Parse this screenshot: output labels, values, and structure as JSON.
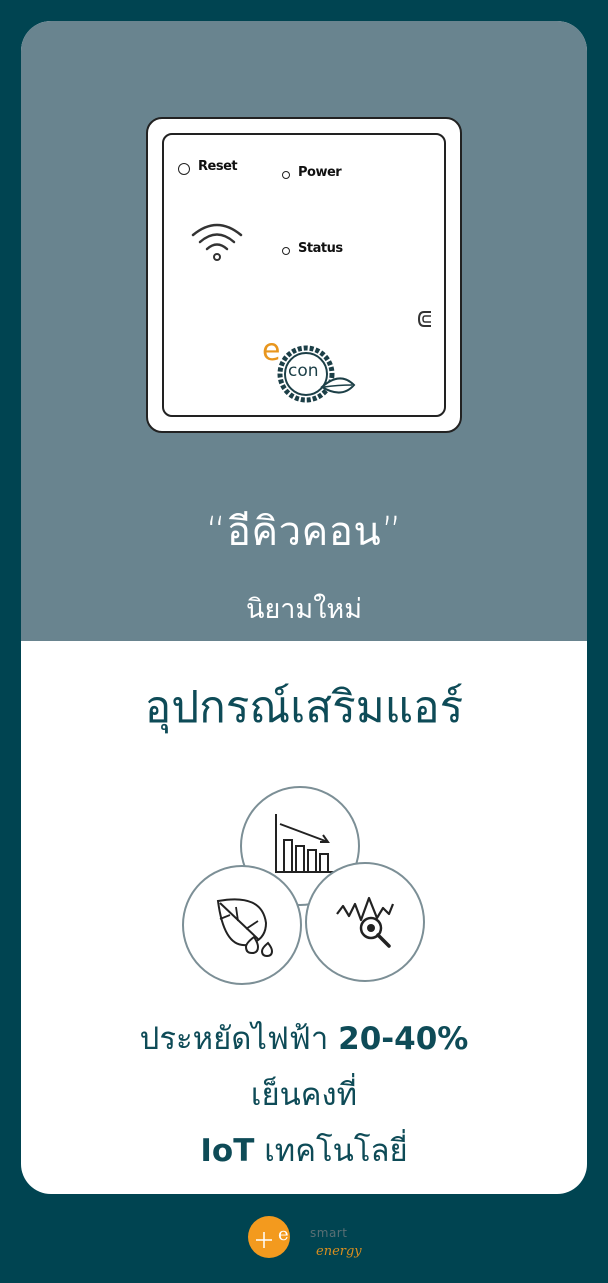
{
  "device": {
    "reset_label": "Reset",
    "power_label": "Power",
    "status_label": "Status",
    "brand_e": "e",
    "brand_con": "con"
  },
  "banner": {
    "title": "“อีคิวคอน”",
    "subtitle": "นิยามใหม่"
  },
  "main": {
    "headline": "อุปกรณ์เสริมแอร์",
    "features": [
      {
        "text": "ประหยัดไฟฟ้า",
        "bold": "20-40%"
      },
      {
        "text": "เย็นคงที่"
      },
      {
        "bold": "IoT",
        "text": "เทคโนโลยี่"
      }
    ]
  },
  "footer": {
    "logo_e": "e",
    "logo_word": "smart",
    "logo_energy": "energy"
  },
  "colors": {
    "background": "#004451",
    "banner": "#69848f",
    "text_dark": "#0e4b57",
    "logo_orange": "#f39a1e"
  },
  "icons": [
    "wifi-icon",
    "bar-chart-down-icon",
    "leaf-drop-icon",
    "line-chart-search-icon",
    "magnet-icon"
  ]
}
